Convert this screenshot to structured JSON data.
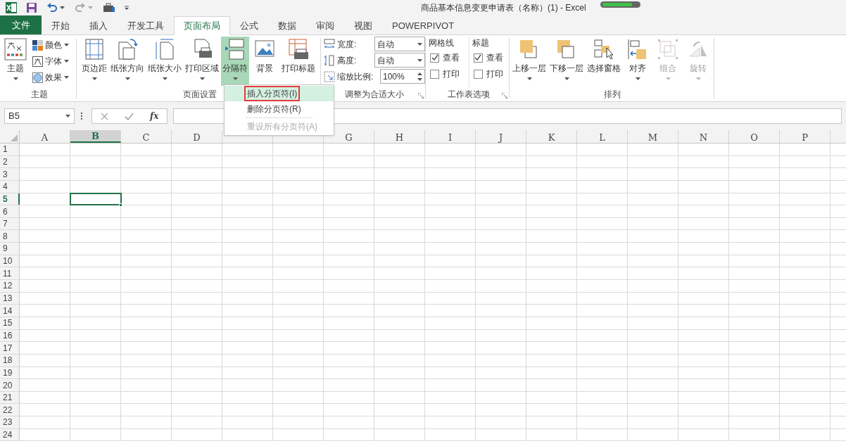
{
  "window": {
    "title": "商品基本信息变更申请表（名称）(1) - Excel"
  },
  "tabs": [
    {
      "label": "文件",
      "selected": false,
      "kind": "file"
    },
    {
      "label": "开始",
      "selected": false,
      "kind": "tab"
    },
    {
      "label": "插入",
      "selected": false,
      "kind": "tab"
    },
    {
      "label": "开发工具",
      "selected": false,
      "kind": "tab"
    },
    {
      "label": "页面布局",
      "selected": true,
      "kind": "tab"
    },
    {
      "label": "公式",
      "selected": false,
      "kind": "tab"
    },
    {
      "label": "数据",
      "selected": false,
      "kind": "tab"
    },
    {
      "label": "审阅",
      "selected": false,
      "kind": "tab"
    },
    {
      "label": "视图",
      "selected": false,
      "kind": "tab"
    },
    {
      "label": "POWERPIVOT",
      "selected": false,
      "kind": "tab"
    }
  ],
  "theme_group": {
    "label": "主题",
    "big_button": "主题",
    "small_buttons": [
      "颜色",
      "字体",
      "效果"
    ]
  },
  "page_setup_group": {
    "label": "页面设置",
    "buttons": [
      {
        "label": "页边距",
        "pressed": false,
        "caret": true
      },
      {
        "label": "纸张方向",
        "pressed": false,
        "caret": true
      },
      {
        "label": "纸张大小",
        "pressed": false,
        "caret": true
      },
      {
        "label": "打印区域",
        "pressed": false,
        "caret": true
      },
      {
        "label": "分隔符",
        "pressed": true,
        "caret": true
      },
      {
        "label": "背景",
        "pressed": false,
        "caret": false
      },
      {
        "label": "打印标题",
        "pressed": false,
        "caret": false
      }
    ]
  },
  "scale_group": {
    "label": "调整为合适大小",
    "rows": [
      {
        "label": "宽度:",
        "value": "自动"
      },
      {
        "label": "高度:",
        "value": "自动"
      },
      {
        "label": "缩放比例:",
        "value": "100%"
      }
    ]
  },
  "sheet_options_group": {
    "label": "工作表选项",
    "columns": [
      {
        "heading": "网格线",
        "options": [
          {
            "label": "查看",
            "checked": true
          },
          {
            "label": "打印",
            "checked": false
          }
        ]
      },
      {
        "heading": "标题",
        "options": [
          {
            "label": "查看",
            "checked": true
          },
          {
            "label": "打印",
            "checked": false
          }
        ]
      }
    ]
  },
  "arrange_group": {
    "label": "排列",
    "buttons": [
      {
        "label": "上移一层",
        "disabled": false
      },
      {
        "label": "下移一层",
        "disabled": false
      },
      {
        "label": "选择窗格",
        "disabled": false
      },
      {
        "label": "对齐",
        "disabled": false
      },
      {
        "label": "组合",
        "disabled": true
      },
      {
        "label": "旋转",
        "disabled": true
      }
    ]
  },
  "name_box": "B5",
  "formula_button": "fx",
  "columns": [
    {
      "label": "A",
      "selected": false
    },
    {
      "label": "B",
      "selected": true
    },
    {
      "label": "C",
      "selected": false
    },
    {
      "label": "D",
      "selected": false
    },
    {
      "selected": false
    },
    {
      "selected": false
    },
    {
      "label": "G",
      "selected": false
    },
    {
      "label": "H",
      "selected": false
    },
    {
      "label": "I",
      "selected": false
    },
    {
      "label": "J",
      "selected": false
    },
    {
      "label": "K",
      "selected": false
    },
    {
      "label": "L",
      "selected": false
    },
    {
      "label": "M",
      "selected": false
    },
    {
      "label": "N",
      "selected": false
    },
    {
      "label": "O",
      "selected": false
    },
    {
      "label": "P",
      "selected": false
    }
  ],
  "rows": [
    {
      "label": "1",
      "selected": false
    },
    {
      "label": "2",
      "selected": false
    },
    {
      "label": "3",
      "selected": false
    },
    {
      "label": "4",
      "selected": false
    },
    {
      "label": "5",
      "selected": true
    },
    {
      "label": "6",
      "selected": false
    },
    {
      "label": "7",
      "selected": false
    },
    {
      "label": "8",
      "selected": false
    },
    {
      "label": "9",
      "selected": false
    },
    {
      "label": "10",
      "selected": false
    },
    {
      "label": "11",
      "selected": false
    },
    {
      "label": "12",
      "selected": false
    },
    {
      "label": "13",
      "selected": false
    },
    {
      "label": "14",
      "selected": false
    },
    {
      "label": "15",
      "selected": false
    },
    {
      "label": "16",
      "selected": false
    },
    {
      "label": "17",
      "selected": false
    },
    {
      "label": "18",
      "selected": false
    },
    {
      "label": "19",
      "selected": false
    },
    {
      "label": "20",
      "selected": false
    },
    {
      "label": "21",
      "selected": false
    },
    {
      "label": "22",
      "selected": false
    },
    {
      "label": "23",
      "selected": false
    },
    {
      "label": "24",
      "selected": false
    }
  ],
  "dropdown_menu": {
    "items": [
      {
        "label": "插入分页符(I)",
        "selected": true,
        "disabled": false
      },
      {
        "label": "删除分页符(R)",
        "selected": false,
        "disabled": false
      },
      {
        "label": "重设所有分页符(A)",
        "selected": false,
        "disabled": true
      }
    ]
  }
}
